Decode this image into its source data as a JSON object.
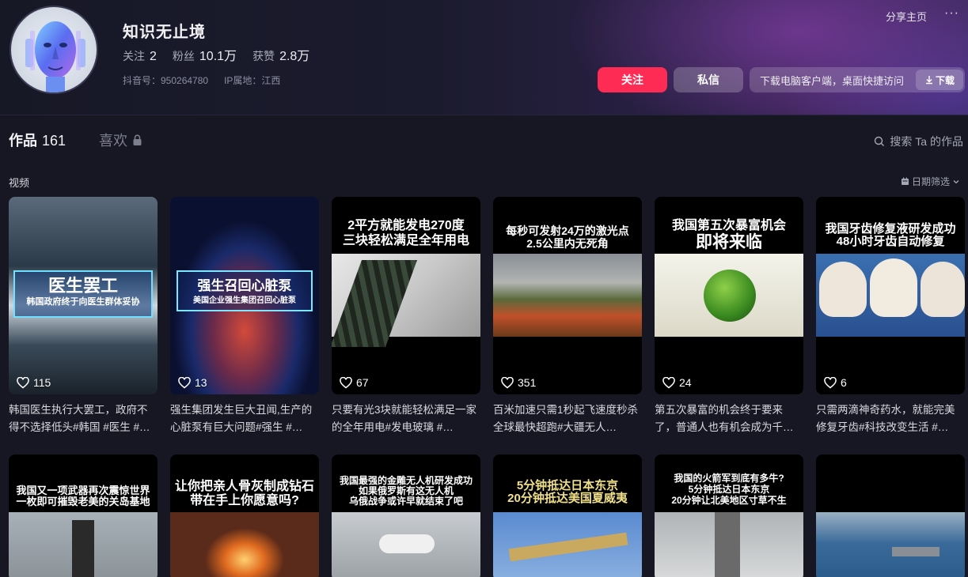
{
  "profile": {
    "name": "知识无止境",
    "following_label": "关注",
    "following_value": "2",
    "followers_label": "粉丝",
    "followers_value": "10.1万",
    "likes_label": "获赞",
    "likes_value": "2.8万",
    "douyin_id": "抖音号：950264780",
    "ip_location": "IP属地：江西"
  },
  "top_right": {
    "share": "分享主页",
    "more": "···"
  },
  "actions": {
    "follow": "关注",
    "message": "私信",
    "download_text": "下载电脑客户端，桌面快捷访问",
    "download_btn": "下载"
  },
  "tabs": {
    "works": "作品",
    "works_count": "161",
    "likes": "喜欢"
  },
  "search": {
    "placeholder": "搜索 Ta 的作品"
  },
  "section": {
    "label": "视频",
    "date_filter": "日期筛选"
  },
  "accent": "#fe2c55",
  "videos": [
    {
      "likes": "115",
      "title": "韩国医生执行大罢工，政府不得不选择低头#韩国 #医生 #…",
      "cap1": "医生罢工",
      "cap2": "韩国政府终于向医生群体妥协"
    },
    {
      "likes": "13",
      "title": "强生集团发生巨大丑闻,生产的心脏泵有巨大问题#强生 #…",
      "cap1": "强生召回心脏泵",
      "cap2": "美国企业强生集团召回心脏泵"
    },
    {
      "likes": "67",
      "title": "只要有光3块就能轻松满足一家的全年用电#发电玻璃 #…",
      "cap1": "2平方就能发电270度",
      "cap2": "三块轻松满足全年用电"
    },
    {
      "likes": "351",
      "title": "百米加速只需1秒起飞速度秒杀全球最快超跑#大疆无人…",
      "cap1": "每秒可发射24万的激光点",
      "cap2": "2.5公里内无死角"
    },
    {
      "likes": "24",
      "title": "第五次暴富的机会终于要来了，普通人也有机会成为千…",
      "cap1": "我国第五次暴富机会",
      "cap2": "即将来临"
    },
    {
      "likes": "6",
      "title": "只需两滴神奇药水，就能完美修复牙齿#科技改变生活 #…",
      "cap1": "我国牙齿修复液研发成功",
      "cap2": "48小时牙齿自动修复"
    }
  ],
  "videos_row2": [
    {
      "cap1": "我国又一项武器再次震惊世界",
      "cap2": "一枚即可摧毁老美的关岛基地"
    },
    {
      "cap1": "让你把亲人骨灰制成钻石",
      "cap2": "带在手上你愿意吗?"
    },
    {
      "cap1": "我国最强的金雕无人机研发成功",
      "cap2": "如果俄罗斯有这无人机",
      "cap3": "乌俄战争或许早就结束了吧"
    },
    {
      "cap1": "5分钟抵达日本东京",
      "cap2": "20分钟抵达美国夏威夷"
    },
    {
      "cap1": "我国的火箭军到底有多牛?",
      "cap2": "5分钟抵达日本东京",
      "cap3": "20分钟让北美地区寸草不生"
    },
    {
      "cap1": ""
    }
  ]
}
